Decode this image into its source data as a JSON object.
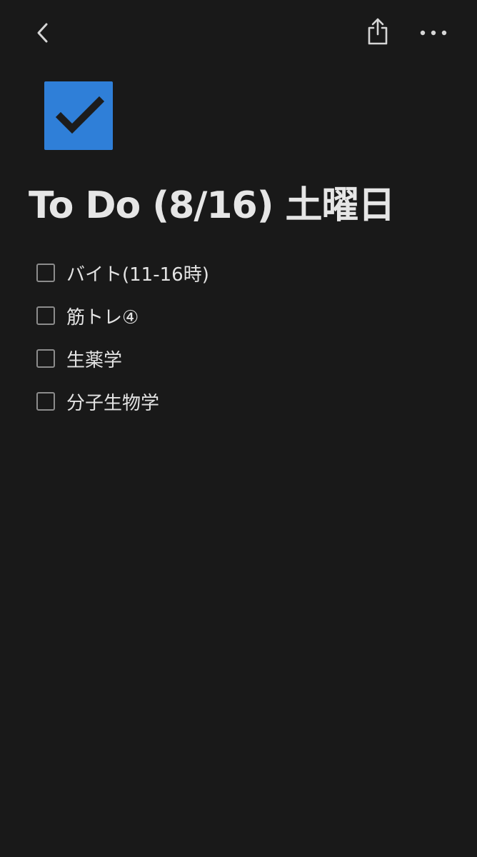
{
  "topbar": {
    "back_icon": "chevron-left-icon",
    "share_icon": "share-icon",
    "more_icon": "more-horizontal-icon"
  },
  "page": {
    "icon": "checkmark-icon",
    "icon_color": "#2f7fd8",
    "title": "To Do (8/16)  土曜日"
  },
  "todos": [
    {
      "label": "バイト(11-16時)",
      "checked": false
    },
    {
      "label": "筋トレ④",
      "checked": false
    },
    {
      "label": "生薬学",
      "checked": false
    },
    {
      "label": "分子生物学",
      "checked": false
    }
  ],
  "colors": {
    "background": "#191919",
    "text": "#e3e3e3",
    "checkbox_border": "#8c8c8c",
    "accent": "#2f7fd8"
  }
}
